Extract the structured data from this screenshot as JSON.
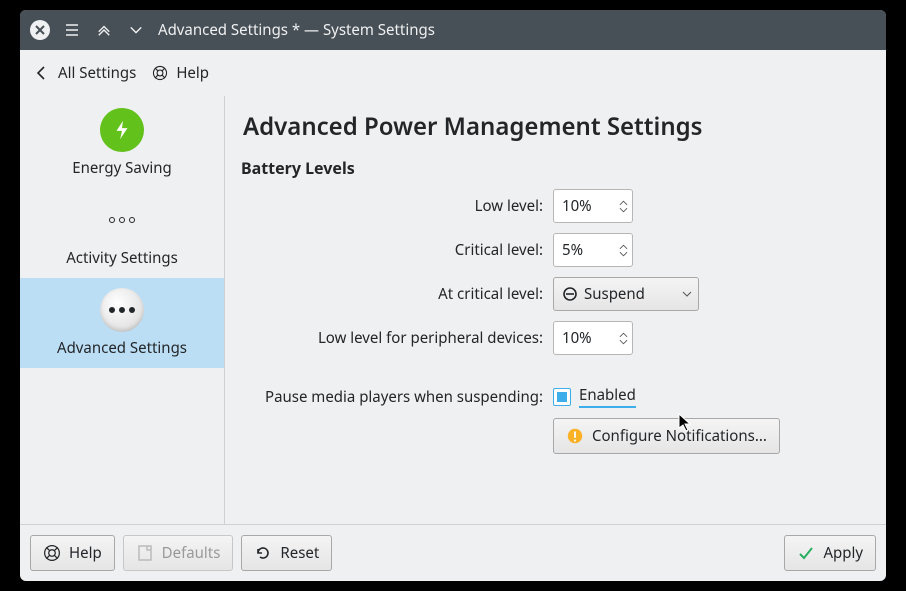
{
  "window": {
    "title": "Advanced Settings * — System Settings"
  },
  "toolbar": {
    "all_settings": "All Settings",
    "help": "Help"
  },
  "sidebar": {
    "items": [
      {
        "label": "Energy Saving"
      },
      {
        "label": "Activity Settings"
      },
      {
        "label": "Advanced Settings"
      }
    ]
  },
  "main": {
    "heading": "Advanced Power Management Settings",
    "section_battery": "Battery Levels",
    "rows": {
      "low_level_label": "Low level:",
      "low_level_value": "10%",
      "critical_level_label": "Critical level:",
      "critical_level_value": "5%",
      "at_critical_label": "At critical level:",
      "at_critical_value": "Suspend",
      "low_peripheral_label": "Low level for peripheral devices:",
      "low_peripheral_value": "10%",
      "pause_media_label": "Pause media players when suspending:",
      "pause_media_value_label": "Enabled",
      "pause_media_checked": true,
      "configure_notifications": "Configure Notifications..."
    }
  },
  "bottom": {
    "help": "Help",
    "defaults": "Defaults",
    "reset": "Reset",
    "apply": "Apply"
  }
}
